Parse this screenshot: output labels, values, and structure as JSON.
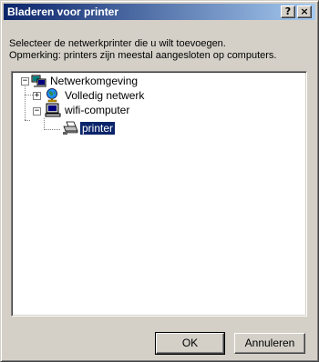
{
  "window": {
    "title": "Bladeren voor printer",
    "help_label": "?",
    "close_label": "×"
  },
  "message": {
    "line1": "Selecteer de netwerkprinter die u wilt toevoegen.",
    "line2": "Opmerking: printers zijn meestal aangesloten op computers."
  },
  "tree": {
    "nodes": [
      {
        "label": "Netwerkomgeving",
        "icon": "network-neighborhood-icon",
        "expander": "−",
        "expanded": true
      },
      {
        "label": "Volledig netwerk",
        "icon": "entire-network-globe-icon",
        "expander": "+",
        "expanded": false
      },
      {
        "label": "wifi-computer",
        "icon": "computer-icon",
        "expander": "−",
        "expanded": true
      },
      {
        "label": "printer",
        "icon": "printer-icon",
        "selected": true
      }
    ]
  },
  "buttons": {
    "ok": "OK",
    "cancel": "Annuleren"
  },
  "colors": {
    "titlebar_start": "#0a246a",
    "titlebar_end": "#a6caf0",
    "selection": "#0a246a",
    "face": "#d4d0c8"
  }
}
